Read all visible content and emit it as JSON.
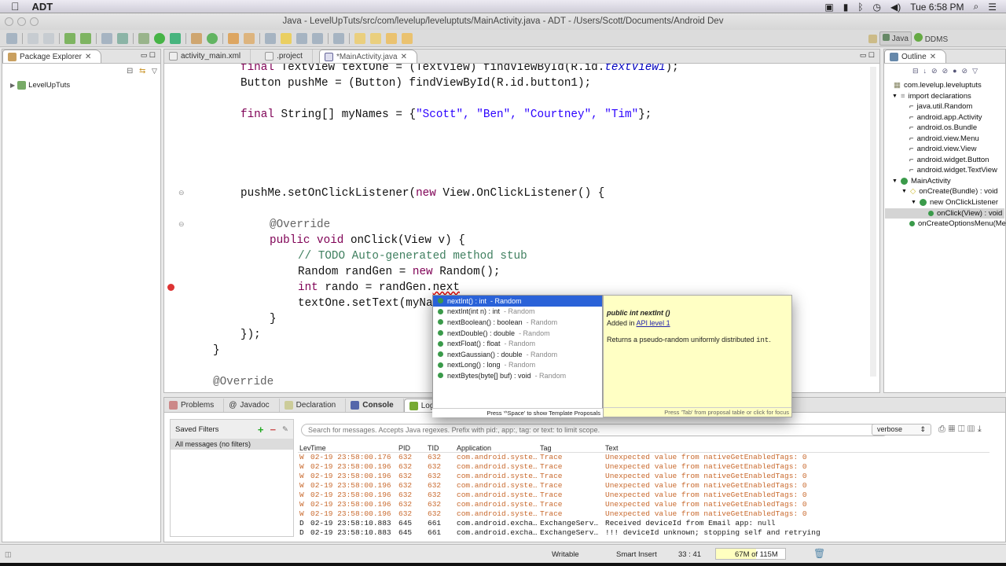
{
  "menubar": {
    "app": "ADT",
    "time": "Tue 6:58 PM"
  },
  "window": {
    "title": "Java - LevelUpTuts/src/com/levelup/leveluptuts/MainActivity.java - ADT - /Users/Scott/Documents/Android Dev"
  },
  "perspectives": {
    "java": "Java",
    "ddms": "DDMS"
  },
  "package_explorer": {
    "title": "Package Explorer",
    "project": "LevelUpTuts"
  },
  "editor": {
    "tabs": [
      {
        "label": "activity_main.xml"
      },
      {
        "label": ".project"
      },
      {
        "label": "*MainActivity.java"
      }
    ],
    "code": {
      "l1a": "final ",
      "l1b": "TextView textOne = (TextView) findViewById(R.id.",
      "l1c": "textView1",
      "l1d": ");",
      "l2": "Button pushMe = (Button) findViewById(R.id.button1);",
      "l3a": "final ",
      "l3b": "String[] myNames = {",
      "l3c": "\"Scott\", \"Ben\", \"Courtney\", \"Tim\"",
      "l3d": "};",
      "l4a": "pushMe.setOnClickListener(",
      "l4b": "new ",
      "l4c": "View.OnClickListener() {",
      "l5": "@Override",
      "l6a": "public void ",
      "l6b": "onClick(View v) {",
      "l7": "// TODO Auto-generated method stub",
      "l8a": "Random randGen = ",
      "l8b": "new ",
      "l8c": "Random();",
      "l9a": "int ",
      "l9b": "rando = randGen.",
      "l9c": "next",
      "l10": "textOne.setText(myNa",
      "l11": "}",
      "l12": "});",
      "l13": "}",
      "l14": "@Override"
    }
  },
  "outline": {
    "title": "Outline",
    "items": [
      "com.levelup.leveluptuts",
      "import declarations",
      "java.util.Random",
      "android.app.Activity",
      "android.os.Bundle",
      "android.view.Menu",
      "android.view.View",
      "android.widget.Button",
      "android.widget.TextView",
      "MainActivity",
      "onCreate(Bundle) : void",
      "new OnClickListener",
      "onClick(View) : void",
      "onCreateOptionsMenu(Menu)"
    ]
  },
  "autocomplete": {
    "proposals": [
      {
        "name": "nextInt() : int",
        "owner": "- Random"
      },
      {
        "name": "nextInt(int n) : int",
        "owner": "- Random"
      },
      {
        "name": "nextBoolean() : boolean",
        "owner": "- Random"
      },
      {
        "name": "nextDouble() : double",
        "owner": "- Random"
      },
      {
        "name": "nextFloat() : float",
        "owner": "- Random"
      },
      {
        "name": "nextGaussian() : double",
        "owner": "- Random"
      },
      {
        "name": "nextLong() : long",
        "owner": "- Random"
      },
      {
        "name": "nextBytes(byte[] buf) : void",
        "owner": "- Random"
      }
    ],
    "footer": "Press '^Space' to show Template Proposals",
    "doc": {
      "signature": "public int nextInt ()",
      "added_prefix": "Added in ",
      "api_link": "API level 1",
      "desc_prefix": "Returns a pseudo-random uniformly distributed ",
      "desc_code": "int",
      "desc_suffix": ".",
      "footer": "Press 'Tab' from proposal table or click for focus"
    }
  },
  "bottom": {
    "tabs": [
      "Problems",
      "Javadoc",
      "Declaration",
      "Console",
      "LogCat"
    ],
    "saved_filters": "Saved Filters",
    "filter_item": "All messages (no filters)",
    "search_placeholder": "Search for messages. Accepts Java regexes. Prefix with pid:, app:, tag: or text: to limit scope.",
    "level_select": "verbose",
    "columns": [
      "Lev",
      "Time",
      "PID",
      "TID",
      "Application",
      "Tag",
      "Text"
    ],
    "rows": [
      [
        "W",
        "02-19 23:58:00.176",
        "632",
        "632",
        "com.android.syste…",
        "Trace",
        "Unexpected value from nativeGetEnabledTags: 0"
      ],
      [
        "W",
        "02-19 23:58:00.196",
        "632",
        "632",
        "com.android.syste…",
        "Trace",
        "Unexpected value from nativeGetEnabledTags: 0"
      ],
      [
        "W",
        "02-19 23:58:00.196",
        "632",
        "632",
        "com.android.syste…",
        "Trace",
        "Unexpected value from nativeGetEnabledTags: 0"
      ],
      [
        "W",
        "02-19 23:58:00.196",
        "632",
        "632",
        "com.android.syste…",
        "Trace",
        "Unexpected value from nativeGetEnabledTags: 0"
      ],
      [
        "W",
        "02-19 23:58:00.196",
        "632",
        "632",
        "com.android.syste…",
        "Trace",
        "Unexpected value from nativeGetEnabledTags: 0"
      ],
      [
        "W",
        "02-19 23:58:00.196",
        "632",
        "632",
        "com.android.syste…",
        "Trace",
        "Unexpected value from nativeGetEnabledTags: 0"
      ],
      [
        "W",
        "02-19 23:58:00.196",
        "632",
        "632",
        "com.android.syste…",
        "Trace",
        "Unexpected value from nativeGetEnabledTags: 0"
      ],
      [
        "D",
        "02-19 23:58:10.883",
        "645",
        "661",
        "com.android.excha…",
        "ExchangeServ…",
        "Received deviceId from Email app: null"
      ],
      [
        "D",
        "02-19 23:58:10.883",
        "645",
        "661",
        "com.android.excha…",
        "ExchangeServ…",
        "!!! deviceId unknown; stopping self and retrying"
      ]
    ]
  },
  "status": {
    "writable": "Writable",
    "insert": "Smart Insert",
    "position": "33 : 41",
    "heap": "67M of 115M",
    "heap_fraction": 0.58
  }
}
